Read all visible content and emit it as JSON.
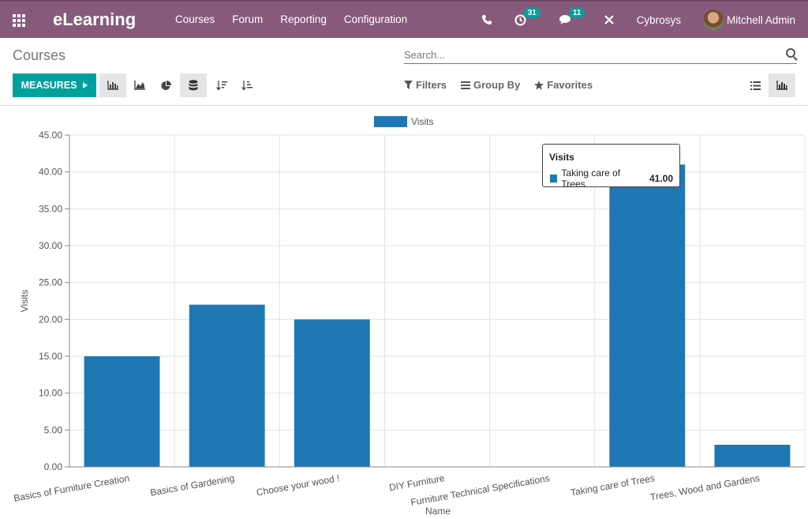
{
  "navbar": {
    "brand": "eLearning",
    "menu": [
      "Courses",
      "Forum",
      "Reporting",
      "Configuration"
    ],
    "activity_count": "31",
    "messages_count": "11",
    "company": "Cybrosys",
    "user": "Mitchell Admin"
  },
  "control": {
    "title": "Courses",
    "search_placeholder": "Search...",
    "measures_label": "MEASURES",
    "filters_label": "Filters",
    "groupby_label": "Group By",
    "favorites_label": "Favorites"
  },
  "colors": {
    "navbar": "#875a7b",
    "primary": "#00a09d",
    "bar": "#1f77b4"
  },
  "chart_data": {
    "type": "bar",
    "categories": [
      "Basics of Furniture Creation",
      "Basics of Gardening",
      "Choose your wood !",
      "DIY Furniture",
      "Furniture Technical Specifications",
      "Taking care of Trees",
      "Trees, Wood and Gardens"
    ],
    "series": [
      {
        "name": "Visits",
        "values": [
          15,
          22,
          20,
          0,
          0,
          41,
          3
        ]
      }
    ],
    "xlabel": "Name",
    "ylabel": "Visits",
    "ylim": [
      0,
      45
    ],
    "yticks": [
      "0.00",
      "5.00",
      "10.00",
      "15.00",
      "20.00",
      "25.00",
      "30.00",
      "35.00",
      "40.00",
      "45.00"
    ],
    "legend": "top-center",
    "grid": true
  },
  "tooltip": {
    "title": "Visits",
    "label": "Taking care of Trees",
    "value": "41.00"
  }
}
